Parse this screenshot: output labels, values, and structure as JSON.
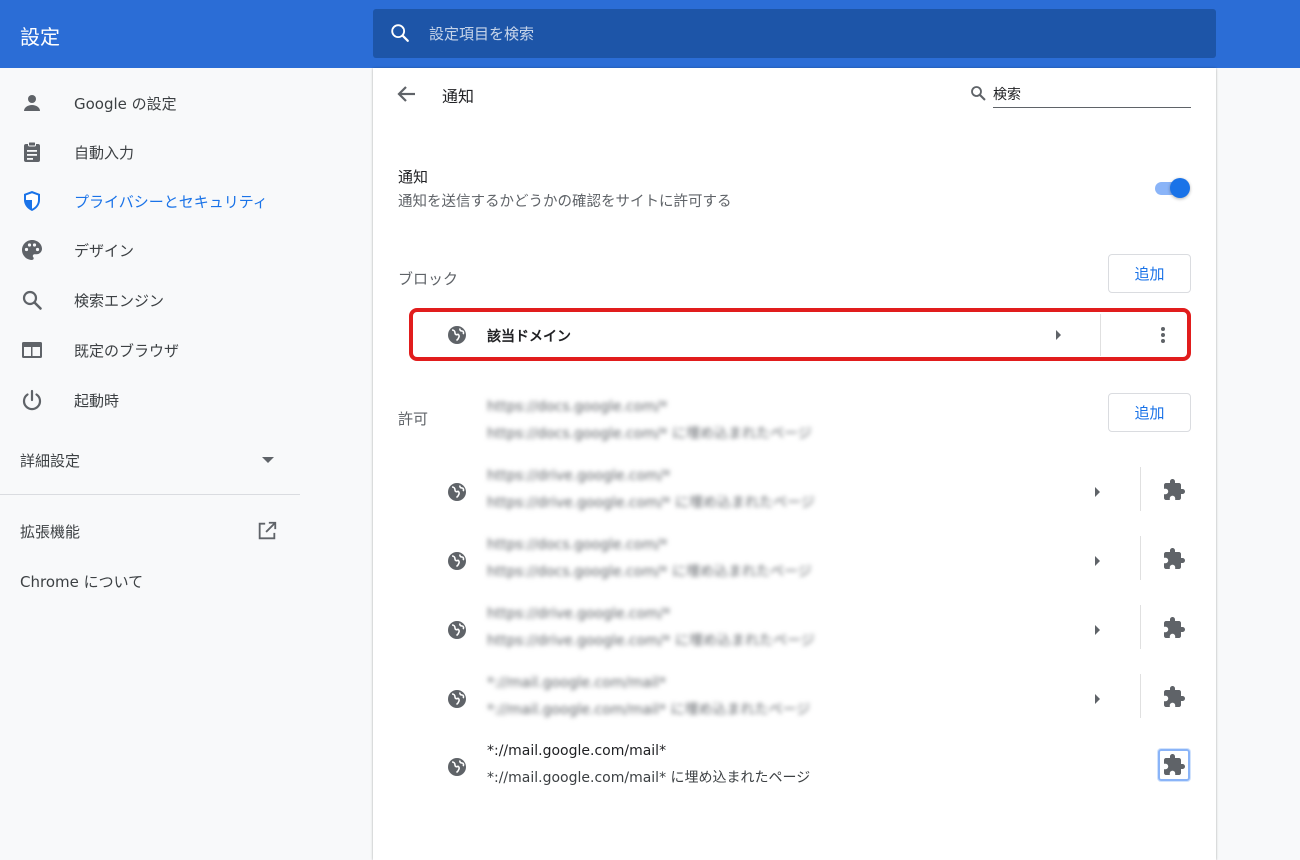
{
  "header": {
    "title": "設定",
    "search_placeholder": "設定項目を検索"
  },
  "sidebar": {
    "items": [
      {
        "label": "Google の設定",
        "icon": "person-icon",
        "active": false
      },
      {
        "label": "自動入力",
        "icon": "clipboard-icon",
        "active": false
      },
      {
        "label": "プライバシーとセキュリティ",
        "icon": "shield-icon",
        "active": true
      },
      {
        "label": "デザイン",
        "icon": "palette-icon",
        "active": false
      },
      {
        "label": "検索エンジン",
        "icon": "search-icon",
        "active": false
      },
      {
        "label": "既定のブラウザ",
        "icon": "browser-window-icon",
        "active": false
      },
      {
        "label": "起動時",
        "icon": "power-icon",
        "active": false
      }
    ],
    "advanced_label": "詳細設定",
    "extensions_label": "拡張機能",
    "about_label": "Chrome について"
  },
  "page": {
    "title": "通知",
    "search_placeholder": "検索",
    "toggle": {
      "title": "通知",
      "description": "通知を送信するかどうかの確認をサイトに許可する",
      "enabled": true
    },
    "block": {
      "label": "ブロック",
      "add_label": "追加",
      "items": [
        {
          "domain": "該当ドメイン"
        }
      ]
    },
    "allow": {
      "label": "許可",
      "add_label": "追加",
      "items": [
        {
          "origin": "https://docs.google.com/*",
          "embed": "https://docs.google.com/* に埋め込まれたページ",
          "blurred": true
        },
        {
          "origin": "https://drive.google.com/*",
          "embed": "https://drive.google.com/* に埋め込まれたページ",
          "blurred": true
        },
        {
          "origin": "https://docs.google.com/*",
          "embed": "https://docs.google.com/* に埋め込まれたページ",
          "blurred": true
        },
        {
          "origin": "https://drive.google.com/*",
          "embed": "https://drive.google.com/* に埋め込まれたページ",
          "blurred": true
        },
        {
          "origin": "*://mail.google.com/mail*",
          "embed": "*://mail.google.com/mail* に埋め込まれたページ",
          "blurred": true
        },
        {
          "origin": "*://mail.google.com/mail*",
          "embed": "*://mail.google.com/mail* に埋め込まれたページ",
          "blurred": false
        }
      ]
    }
  },
  "colors": {
    "header_bg": "#2b6dd6",
    "search_bg": "#1d55a8",
    "accent": "#1a73e8",
    "highlight": "#e11d1d"
  }
}
